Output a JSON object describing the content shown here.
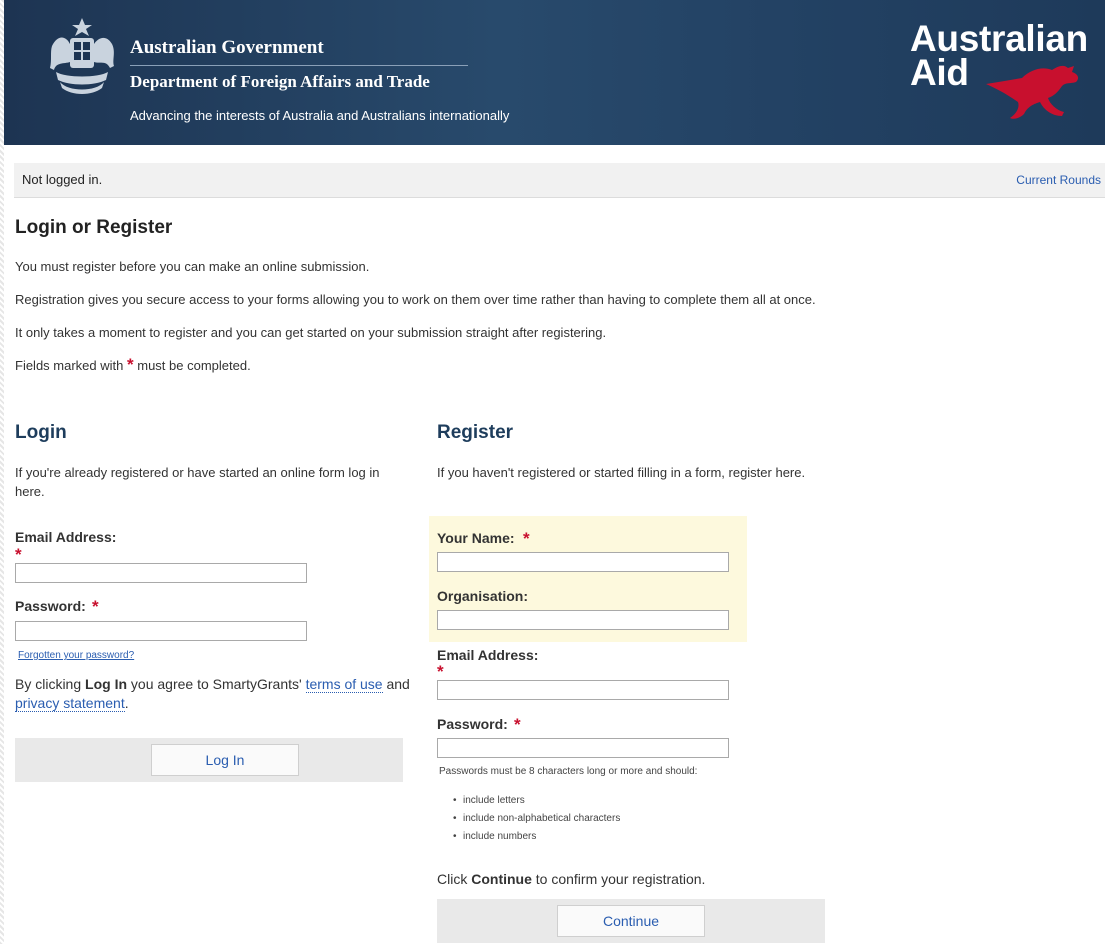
{
  "header": {
    "gov_name": "Australian Government",
    "dept_name": "Department of Foreign Affairs and Trade",
    "tagline": "Advancing the interests of Australia and Australians internationally",
    "aid_logo_line1": "Australian",
    "aid_logo_line2": "Aid",
    "aid_logo_color": "#c8102e"
  },
  "statusbar": {
    "status": "Not logged in.",
    "current_rounds": "Current Rounds"
  },
  "intro": {
    "title": "Login or Register",
    "p1": "You must register before you can make an online submission.",
    "p2": "Registration gives you secure access to your forms allowing you to work on them over time rather than having to complete them all at once.",
    "p3": "It only takes a moment to register and you can get started on your submission straight after registering.",
    "required_pre": "Fields marked with",
    "required_post": "must be completed."
  },
  "login": {
    "title": "Login",
    "intro": "If you're already registered or have started an online form log in here.",
    "email_label": "Email Address:",
    "email_value": "",
    "password_label": "Password:",
    "password_value": "",
    "forgot": "Forgotten your password?",
    "agree_pre": "By clicking",
    "agree_bold": "Log In",
    "agree_mid": "you agree to SmartyGrants'",
    "terms": "terms of use",
    "agree_and": "and",
    "privacy": "privacy statement",
    "agree_end": ".",
    "button": "Log In"
  },
  "register": {
    "title": "Register",
    "intro": "If you haven't registered or started filling in a form, register here.",
    "name_label": "Your Name:",
    "name_value": "",
    "org_label": "Organisation:",
    "org_value": "",
    "email_label": "Email Address:",
    "email_value": "",
    "password_label": "Password:",
    "password_value": "",
    "pw_hint": "Passwords must be 8 characters long or more and should:",
    "pw_rules": [
      "include letters",
      "include non-alphabetical characters",
      "include numbers"
    ],
    "confirm_pre": "Click",
    "confirm_bold": "Continue",
    "confirm_post": "to confirm your registration.",
    "button": "Continue"
  },
  "required_marker": "*",
  "colors": {
    "header_bg": "#234264",
    "link": "#2a5db0",
    "required": "#c8102e",
    "heading": "#1e3d5c",
    "highlight": "#fdf9dd"
  }
}
